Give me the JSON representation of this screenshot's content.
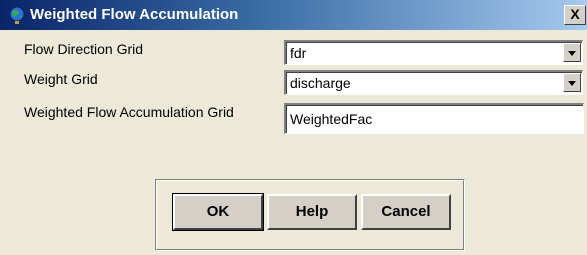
{
  "window": {
    "title": "Weighted Flow Accumulation",
    "close_label": "X"
  },
  "icons": {
    "title_icon": "globe-arcview-icon",
    "close_icon": "close-icon",
    "dropdown_icon": "chevron-down-icon"
  },
  "form": {
    "flow_direction": {
      "label": "Flow Direction Grid",
      "value": "fdr"
    },
    "weight": {
      "label": "Weight Grid",
      "value": "discharge"
    },
    "output": {
      "label": "Weighted Flow Accumulation Grid",
      "value": "WeightedFac"
    }
  },
  "buttons": {
    "ok": "OK",
    "help": "Help",
    "cancel": "Cancel"
  },
  "colors": {
    "dialog_bg": "#ece9d8",
    "titlebar_start": "#0a246a",
    "titlebar_end": "#a6caf0",
    "button_face": "#d4d0c8"
  }
}
